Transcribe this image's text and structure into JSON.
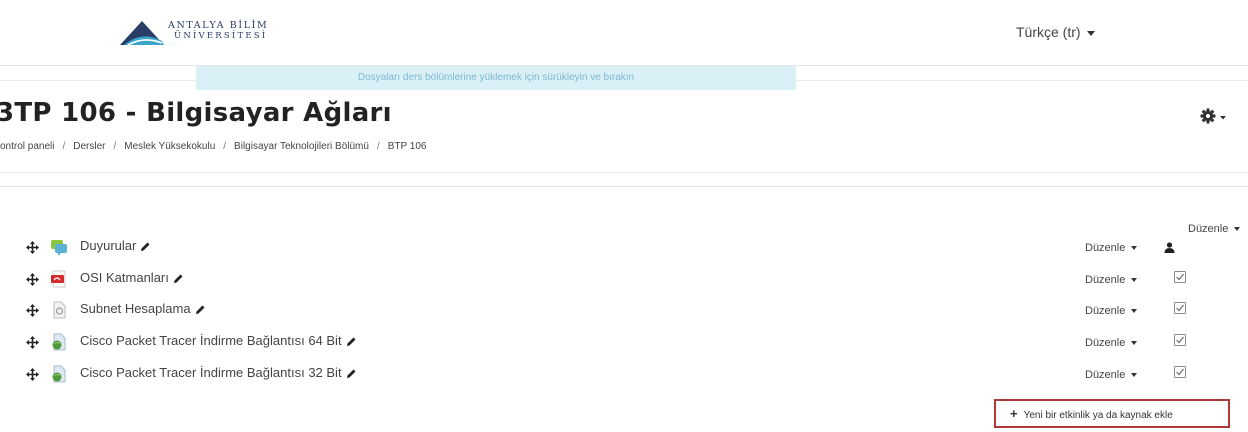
{
  "header": {
    "logo_line1": "ANTALYA BİLİM",
    "logo_line2": "ÜNİVERSİTESİ",
    "language": "Türkçe (tr)",
    "logo_color": "#2a3d66"
  },
  "dropzone": {
    "text": "Dosyaları ders bölümlerine yüklemek için sürükleyin ve bırakın",
    "bg_color": "#daf0f7"
  },
  "course": {
    "title": "3TP 106 - Bilgisayar Ağları"
  },
  "breadcrumb": [
    "ontrol paneli",
    "Dersler",
    "Meslek Yüksekokulu",
    "Bilgisayar Teknolojileri Bölümü",
    "BTP 106"
  ],
  "section": {
    "edit_label": "Düzenle"
  },
  "activities": [
    {
      "name": "Duyurular",
      "icon": "forum-icon",
      "edit_label": "Düzenle",
      "trailing_icon": "user-icon"
    },
    {
      "name": "OSI Katmanları",
      "icon": "pdf-icon",
      "edit_label": "Düzenle",
      "trailing_icon": "checkbox-icon"
    },
    {
      "name": "Subnet Hesaplama",
      "icon": "file-icon",
      "edit_label": "Düzenle",
      "trailing_icon": "checkbox-icon"
    },
    {
      "name": "Cisco Packet Tracer İndirme Bağlantısı 64 Bit",
      "icon": "url-icon",
      "edit_label": "Düzenle",
      "trailing_icon": "checkbox-icon"
    },
    {
      "name": "Cisco Packet Tracer İndirme Bağlantısı 32 Bit",
      "icon": "url-icon",
      "edit_label": "Düzenle",
      "trailing_icon": "checkbox-icon"
    }
  ],
  "add_activity": {
    "label": "Yeni bir etkinlik ya da kaynak ekle",
    "border_color": "#b03a3a"
  }
}
